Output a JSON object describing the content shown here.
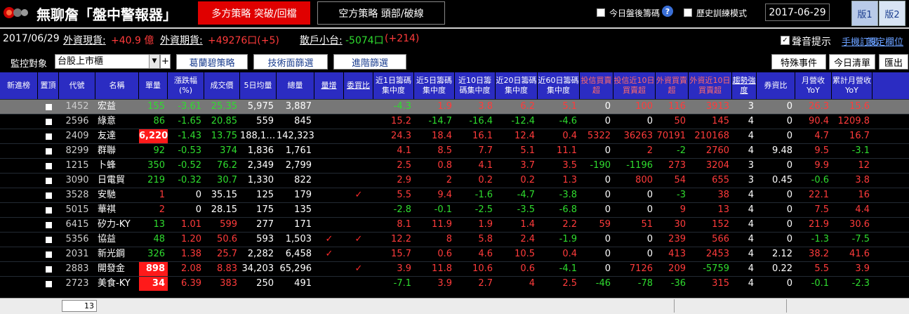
{
  "app": {
    "title": "無聊詹「盤中警報器」"
  },
  "strategy": {
    "long_label": "多方策略  突破/回檔",
    "short_label": "空方策略  頭部/破線"
  },
  "toolbar": {
    "today_after_market": "今日盤後籌碼",
    "history_mode": "歷史訓練模式",
    "date": "2017-06-29",
    "version1": "版1",
    "version2": "版2"
  },
  "info": {
    "date": "2017/06/29",
    "foreign_spot_label": "外資現貨:",
    "foreign_spot_value": "+40.9 億",
    "foreign_futures_label": "外資期貨:",
    "foreign_futures_value": "+49276口(+5)",
    "retail_label": "散戶小台:",
    "retail_value_a": "-5074口",
    "retail_value_b": "(+214)",
    "sound_label": "聲音提示",
    "phone_sub": "手機訂閱",
    "col_set": "設定欄位"
  },
  "filters": {
    "monitor_label": "監控對象",
    "monitor_value": "台股上市櫃",
    "plus": "+",
    "btn1": "葛蘭碧策略",
    "btn2": "技術面篩選",
    "btn3": "進階篩選",
    "special": "特殊事件",
    "today_list": "今日清單",
    "export": "匯出"
  },
  "columns": [
    {
      "label": "新進榜"
    },
    {
      "label": "置頂"
    },
    {
      "label": "代號"
    },
    {
      "label": "名稱"
    },
    {
      "label": "單量"
    },
    {
      "label": "漲跌幅(%)"
    },
    {
      "label": "成交價"
    },
    {
      "label": "5日均量"
    },
    {
      "label": "總量"
    },
    {
      "label": "量增"
    },
    {
      "label": "委買比"
    },
    {
      "label": "近1日籌碼集中度"
    },
    {
      "label": "近5日籌碼集中度"
    },
    {
      "label": "近10日籌碼集中度"
    },
    {
      "label": "近20日籌碼集中度"
    },
    {
      "label": "近60日籌碼集中度"
    },
    {
      "label": "投信買賣超"
    },
    {
      "label": "投信近10日買賣超"
    },
    {
      "label": "外資買賣超"
    },
    {
      "label": "外資近10日買賣超"
    },
    {
      "label": "趨勢強度"
    },
    {
      "label": "券資比"
    },
    {
      "label": "月營收YoY"
    },
    {
      "label": "累計月營收YoY"
    }
  ],
  "rows": [
    {
      "code": "1452",
      "name": "宏益",
      "vol": "155",
      "vol_hl": false,
      "pct": "-3.61",
      "pct_c": "g",
      "price": "25.35",
      "price_c": "g",
      "avg5": "5,975",
      "total": "3,887",
      "vinc": "",
      "bidr": "",
      "c1": "-4.3",
      "c1c": "g",
      "c5": "1.9",
      "c5c": "r",
      "c10": "3.8",
      "c10c": "r",
      "c20": "6.2",
      "c20c": "r",
      "c60": "5.1",
      "c60c": "r",
      "it": "0",
      "itc": "w",
      "it10": "100",
      "it10c": "r",
      "fi": "116",
      "fic": "r",
      "fi10": "3913",
      "fi10c": "r",
      "trend": "3",
      "margin": "0",
      "yoy": "26.3",
      "yoyc": "r",
      "cyoy": "15.6",
      "cyoyc": "r",
      "sel": true
    },
    {
      "code": "2596",
      "name": "綠意",
      "vol": "86",
      "vol_hl": false,
      "pct": "-1.65",
      "pct_c": "g",
      "price": "20.85",
      "price_c": "g",
      "avg5": "559",
      "total": "845",
      "vinc": "",
      "bidr": "",
      "c1": "15.2",
      "c1c": "r",
      "c5": "-14.7",
      "c5c": "g",
      "c10": "-16.4",
      "c10c": "g",
      "c20": "-12.4",
      "c20c": "g",
      "c60": "-4.6",
      "c60c": "g",
      "it": "0",
      "itc": "w",
      "it10": "0",
      "it10c": "w",
      "fi": "50",
      "fic": "r",
      "fi10": "145",
      "fi10c": "r",
      "trend": "4",
      "margin": "0",
      "yoy": "90.4",
      "yoyc": "r",
      "cyoy": "1209.8",
      "cyoyc": "r",
      "sel": false
    },
    {
      "code": "2409",
      "name": "友達",
      "vol": "6,220",
      "vol_hl": true,
      "pct": "-1.43",
      "pct_c": "g",
      "price": "13.75",
      "price_c": "g",
      "avg5": "188,1…",
      "total": "142,323",
      "vinc": "",
      "bidr": "",
      "c1": "24.3",
      "c1c": "r",
      "c5": "18.4",
      "c5c": "r",
      "c10": "16.1",
      "c10c": "r",
      "c20": "12.4",
      "c20c": "r",
      "c60": "0.4",
      "c60c": "r",
      "it": "5322",
      "itc": "r",
      "it10": "36263",
      "it10c": "r",
      "fi": "70191",
      "fic": "r",
      "fi10": "210168",
      "fi10c": "r",
      "trend": "4",
      "margin": "0",
      "yoy": "4.7",
      "yoyc": "r",
      "cyoy": "16.7",
      "cyoyc": "r",
      "sel": false
    },
    {
      "code": "8299",
      "name": "群聯",
      "vol": "92",
      "vol_hl": false,
      "pct": "-0.53",
      "pct_c": "g",
      "price": "374",
      "price_c": "g",
      "avg5": "1,836",
      "total": "1,761",
      "vinc": "",
      "bidr": "",
      "c1": "4.1",
      "c1c": "r",
      "c5": "8.5",
      "c5c": "r",
      "c10": "7.7",
      "c10c": "r",
      "c20": "5.1",
      "c20c": "r",
      "c60": "11.1",
      "c60c": "r",
      "it": "0",
      "itc": "w",
      "it10": "2",
      "it10c": "r",
      "fi": "-2",
      "fic": "g",
      "fi10": "2760",
      "fi10c": "r",
      "trend": "4",
      "margin": "9.48",
      "yoy": "9.5",
      "yoyc": "r",
      "cyoy": "-3.1",
      "cyoyc": "g",
      "sel": false
    },
    {
      "code": "1215",
      "name": "卜蜂",
      "vol": "350",
      "vol_hl": false,
      "pct": "-0.52",
      "pct_c": "g",
      "price": "76.2",
      "price_c": "g",
      "avg5": "2,349",
      "total": "2,799",
      "vinc": "",
      "bidr": "",
      "c1": "2.5",
      "c1c": "r",
      "c5": "0.8",
      "c5c": "r",
      "c10": "4.1",
      "c10c": "r",
      "c20": "3.7",
      "c20c": "r",
      "c60": "3.5",
      "c60c": "r",
      "it": "-190",
      "itc": "g",
      "it10": "-1196",
      "it10c": "g",
      "fi": "273",
      "fic": "r",
      "fi10": "3204",
      "fi10c": "r",
      "trend": "3",
      "margin": "0",
      "yoy": "9.9",
      "yoyc": "r",
      "cyoy": "12",
      "cyoyc": "r",
      "sel": false
    },
    {
      "code": "3090",
      "name": "日電貿",
      "vol": "219",
      "vol_hl": false,
      "pct": "-0.32",
      "pct_c": "g",
      "price": "30.7",
      "price_c": "g",
      "avg5": "1,330",
      "total": "822",
      "vinc": "",
      "bidr": "",
      "c1": "2.9",
      "c1c": "r",
      "c5": "2",
      "c5c": "r",
      "c10": "0.2",
      "c10c": "r",
      "c20": "0.2",
      "c20c": "r",
      "c60": "1.3",
      "c60c": "r",
      "it": "0",
      "itc": "w",
      "it10": "800",
      "it10c": "r",
      "fi": "54",
      "fic": "r",
      "fi10": "655",
      "fi10c": "r",
      "trend": "3",
      "margin": "0.45",
      "yoy": "-0.6",
      "yoyc": "g",
      "cyoy": "3.8",
      "cyoyc": "r",
      "sel": false
    },
    {
      "code": "3528",
      "name": "安馳",
      "vol": "1",
      "vol_hl": false,
      "vol_c": "r",
      "pct": "0",
      "pct_c": "w",
      "price": "35.15",
      "price_c": "w",
      "avg5": "125",
      "total": "179",
      "vinc": "",
      "bidr": "✓",
      "c1": "5.5",
      "c1c": "r",
      "c5": "9.4",
      "c5c": "r",
      "c10": "-1.6",
      "c10c": "g",
      "c20": "-4.7",
      "c20c": "g",
      "c60": "-3.8",
      "c60c": "g",
      "it": "0",
      "itc": "w",
      "it10": "0",
      "it10c": "w",
      "fi": "-3",
      "fic": "g",
      "fi10": "38",
      "fi10c": "r",
      "trend": "4",
      "margin": "0",
      "yoy": "22.1",
      "yoyc": "r",
      "cyoy": "16",
      "cyoyc": "r",
      "sel": false
    },
    {
      "code": "5015",
      "name": "華祺",
      "vol": "2",
      "vol_hl": false,
      "vol_c": "r",
      "pct": "0",
      "pct_c": "w",
      "price": "28.15",
      "price_c": "w",
      "avg5": "175",
      "total": "135",
      "vinc": "",
      "bidr": "",
      "c1": "-2.8",
      "c1c": "g",
      "c5": "-0.1",
      "c5c": "g",
      "c10": "-2.5",
      "c10c": "g",
      "c20": "-3.5",
      "c20c": "g",
      "c60": "-6.8",
      "c60c": "g",
      "it": "0",
      "itc": "w",
      "it10": "0",
      "it10c": "w",
      "fi": "9",
      "fic": "r",
      "fi10": "13",
      "fi10c": "r",
      "trend": "4",
      "margin": "0",
      "yoy": "7.5",
      "yoyc": "r",
      "cyoy": "4.4",
      "cyoyc": "r",
      "sel": false
    },
    {
      "code": "6415",
      "name": "矽力-KY",
      "vol": "13",
      "vol_hl": false,
      "pct": "1.01",
      "pct_c": "r",
      "price": "599",
      "price_c": "r",
      "avg5": "277",
      "total": "171",
      "vinc": "",
      "bidr": "",
      "c1": "8.1",
      "c1c": "r",
      "c5": "11.9",
      "c5c": "r",
      "c10": "1.9",
      "c10c": "r",
      "c20": "1.4",
      "c20c": "r",
      "c60": "2.2",
      "c60c": "r",
      "it": "59",
      "itc": "r",
      "it10": "51",
      "it10c": "r",
      "fi": "30",
      "fic": "r",
      "fi10": "152",
      "fi10c": "r",
      "trend": "4",
      "margin": "0",
      "yoy": "21.9",
      "yoyc": "r",
      "cyoy": "30.6",
      "cyoyc": "r",
      "sel": false
    },
    {
      "code": "5356",
      "name": "協益",
      "vol": "48",
      "vol_hl": false,
      "pct": "1.20",
      "pct_c": "r",
      "price": "50.6",
      "price_c": "r",
      "avg5": "593",
      "total": "1,503",
      "vinc": "✓",
      "bidr": "✓",
      "c1": "12.2",
      "c1c": "r",
      "c5": "8",
      "c5c": "r",
      "c10": "5.8",
      "c10c": "r",
      "c20": "2.4",
      "c20c": "r",
      "c60": "-1.9",
      "c60c": "g",
      "it": "0",
      "itc": "w",
      "it10": "0",
      "it10c": "w",
      "fi": "239",
      "fic": "r",
      "fi10": "566",
      "fi10c": "r",
      "trend": "4",
      "margin": "0",
      "yoy": "-1.3",
      "yoyc": "g",
      "cyoy": "-7.5",
      "cyoyc": "g",
      "sel": false
    },
    {
      "code": "2031",
      "name": "新光鋼",
      "vol": "326",
      "vol_hl": false,
      "pct": "1.38",
      "pct_c": "r",
      "price": "25.7",
      "price_c": "r",
      "avg5": "2,282",
      "total": "6,458",
      "vinc": "✓",
      "bidr": "",
      "c1": "15.7",
      "c1c": "r",
      "c5": "0.6",
      "c5c": "r",
      "c10": "4.6",
      "c10c": "r",
      "c20": "10.5",
      "c20c": "r",
      "c60": "0.4",
      "c60c": "r",
      "it": "0",
      "itc": "w",
      "it10": "0",
      "it10c": "w",
      "fi": "413",
      "fic": "r",
      "fi10": "2453",
      "fi10c": "r",
      "trend": "4",
      "margin": "2.12",
      "yoy": "38.2",
      "yoyc": "r",
      "cyoy": "41.6",
      "cyoyc": "r",
      "sel": false
    },
    {
      "code": "2883",
      "name": "開發金",
      "vol": "898",
      "vol_hl": true,
      "pct": "2.08",
      "pct_c": "r",
      "price": "8.83",
      "price_c": "r",
      "avg5": "34,203",
      "total": "65,296",
      "vinc": "",
      "bidr": "✓",
      "c1": "3.9",
      "c1c": "r",
      "c5": "11.8",
      "c5c": "r",
      "c10": "10.6",
      "c10c": "r",
      "c20": "0.6",
      "c20c": "r",
      "c60": "-4.1",
      "c60c": "g",
      "it": "0",
      "itc": "w",
      "it10": "7126",
      "it10c": "r",
      "fi": "209",
      "fic": "r",
      "fi10": "-5759",
      "fi10c": "g",
      "trend": "4",
      "margin": "0.22",
      "yoy": "5.5",
      "yoyc": "r",
      "cyoy": "3.9",
      "cyoyc": "r",
      "sel": false
    },
    {
      "code": "2723",
      "name": "美食-KY",
      "vol": "34",
      "vol_hl": true,
      "pct": "6.39",
      "pct_c": "r",
      "price": "383",
      "price_c": "r",
      "avg5": "250",
      "total": "491",
      "vinc": "",
      "bidr": "",
      "c1": "-7.1",
      "c1c": "g",
      "c5": "3.9",
      "c5c": "r",
      "c10": "2.7",
      "c10c": "r",
      "c20": "4",
      "c20c": "r",
      "c60": "2.5",
      "c60c": "r",
      "it": "-46",
      "itc": "g",
      "it10": "-78",
      "it10c": "g",
      "fi": "-36",
      "fic": "g",
      "fi10": "315",
      "fi10c": "r",
      "trend": "4",
      "margin": "0",
      "yoy": "-0.1",
      "yoyc": "g",
      "cyoy": "-2.3",
      "cyoyc": "g",
      "sel": false
    }
  ],
  "status": {
    "count": "13"
  },
  "colors": {
    "header_bg": "#2b2cc2",
    "accent_red": "#e00000",
    "up": "#ff3b3b",
    "down": "#2fdc2f"
  }
}
